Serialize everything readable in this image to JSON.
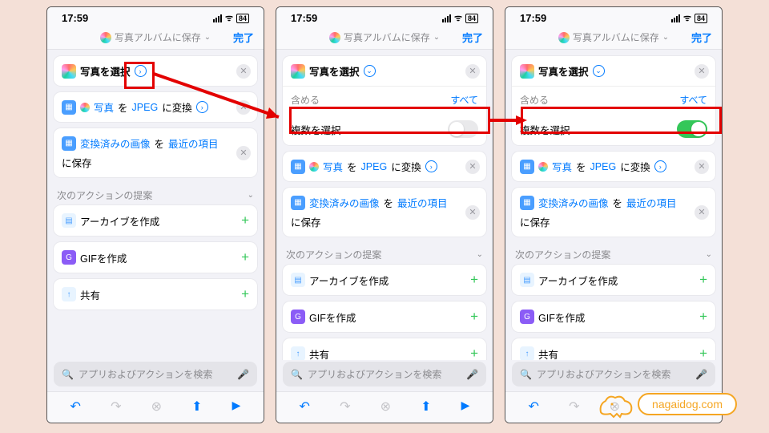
{
  "status": {
    "time": "17:59",
    "battery": "84"
  },
  "header": {
    "title": "写真アルバムに保存",
    "done": "完了"
  },
  "selectPhotos": "写真を選択",
  "include": {
    "label": "含める",
    "all": "すべて"
  },
  "multiSelect": "複数を選択",
  "convert": {
    "p1": "写真",
    "p2": "を",
    "p3": "JPEG",
    "p4": "に変換"
  },
  "save": {
    "p1": "変換済みの画像",
    "p2": "を",
    "p3": "最近の項目",
    "p4": "に保存"
  },
  "suggest": "次のアクションの提案",
  "actions": {
    "archive": "アーカイブを作成",
    "gif": "GIFを作成",
    "share": "共有"
  },
  "search": "アプリおよびアクションを検索",
  "logo": "nagaidog.com"
}
